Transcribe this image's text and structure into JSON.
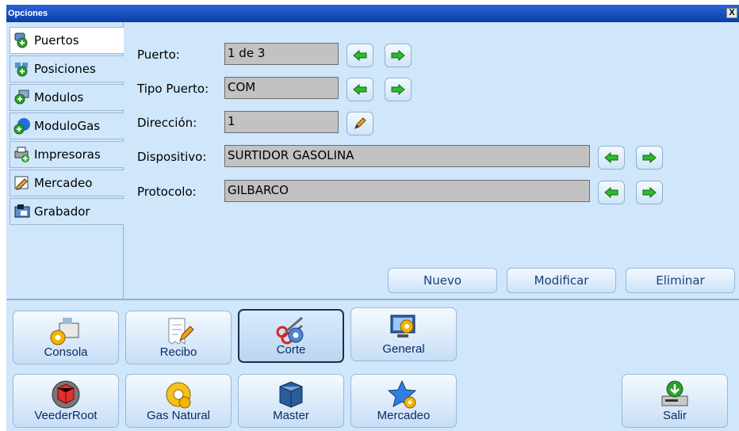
{
  "window": {
    "title": "Opciones",
    "close_label": "X"
  },
  "tabs": [
    {
      "label": "Puertos",
      "icon": "ports-icon",
      "active": true
    },
    {
      "label": "Posiciones",
      "icon": "positions-icon",
      "active": false
    },
    {
      "label": "Modulos",
      "icon": "modules-icon",
      "active": false
    },
    {
      "label": "ModuloGas",
      "icon": "gas-module-icon",
      "active": false
    },
    {
      "label": "Impresoras",
      "icon": "printer-icon",
      "active": false
    },
    {
      "label": "Mercadeo",
      "icon": "marketing-icon",
      "active": false
    },
    {
      "label": "Grabador",
      "icon": "recorder-icon",
      "active": false
    }
  ],
  "form": {
    "puerto_label": "Puerto:",
    "puerto_value": "1 de 3",
    "tipo_label": "Tipo Puerto:",
    "tipo_value": "COM",
    "direccion_label": "Dirección:",
    "direccion_value": "1",
    "dispositivo_label": "Dispositivo:",
    "dispositivo_value": "SURTIDOR GASOLINA",
    "protocolo_label": "Protocolo:",
    "protocolo_value": "GILBARCO"
  },
  "actions": {
    "nuevo": "Nuevo",
    "modificar": "Modificar",
    "eliminar": "Eliminar"
  },
  "bottom_buttons": [
    {
      "label": "Consola",
      "icon": "cash-register-gear-icon"
    },
    {
      "label": "Recibo",
      "icon": "receipt-pencil-icon"
    },
    {
      "label": "Corte",
      "icon": "scissors-gear-icon",
      "pressed": true
    },
    {
      "label": "General",
      "icon": "monitor-gear-icon"
    },
    {
      "label": "VeederRoot",
      "icon": "cube-gear-icon"
    },
    {
      "label": "Gas Natural",
      "icon": "gas-gear-icon"
    },
    {
      "label": "Master",
      "icon": "server-icon"
    },
    {
      "label": "Mercadeo",
      "icon": "star-gear-icon"
    },
    {
      "label": "Salir",
      "icon": "exit-download-icon"
    }
  ],
  "colors": {
    "title_bar": "#0a3fa8",
    "background": "#cfe6fb",
    "arrow_green": "#2dbb2d",
    "button_text": "#1d3f7a"
  }
}
